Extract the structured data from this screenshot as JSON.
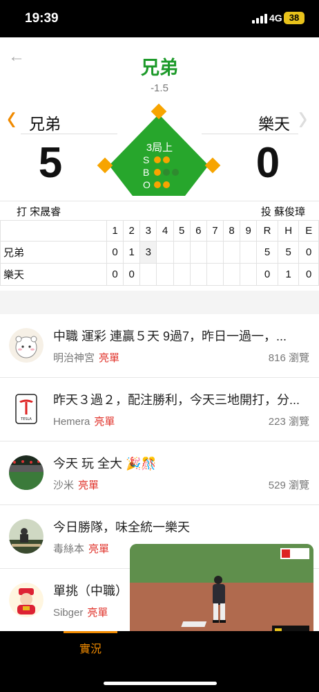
{
  "status": {
    "time": "19:39",
    "network": "4G",
    "battery": "38"
  },
  "header": {
    "title": "兄弟",
    "spread": "-1.5"
  },
  "game": {
    "away": {
      "name": "兄弟",
      "score": "5"
    },
    "home": {
      "name": "樂天",
      "score": "0"
    },
    "inning": "3局上",
    "count": {
      "strikes": 2,
      "balls": 1,
      "outs": 2,
      "s_label": "S",
      "b_label": "B",
      "o_label": "O"
    },
    "batter": "打 宋晟睿",
    "pitcher": "投 蘇俊璋"
  },
  "linescore": {
    "columns": [
      "1",
      "2",
      "3",
      "4",
      "5",
      "6",
      "7",
      "8",
      "9",
      "R",
      "H",
      "E"
    ],
    "rows": [
      {
        "team": "兄弟",
        "cells": [
          "0",
          "1",
          "3",
          "",
          "",
          "",
          "",
          "",
          "",
          "5",
          "5",
          "0"
        ]
      },
      {
        "team": "樂天",
        "cells": [
          "0",
          "0",
          "",
          "",
          "",
          "",
          "",
          "",
          "",
          "0",
          "1",
          "0"
        ]
      }
    ]
  },
  "posts": [
    {
      "title": "中職 運彩 連贏５天 9過7，昨日一過一，...",
      "author": "明治神宮",
      "badge": "亮單",
      "views": "816 瀏覽",
      "avatar_icon": "chiikawa-avatar-icon"
    },
    {
      "title": "昨天３過２，配注勝利，今天三地開打，分...",
      "author": "Hemera",
      "badge": "亮單",
      "views": "223 瀏覽",
      "avatar_icon": "tesla-logo-icon"
    },
    {
      "title": "今天 玩 全大 🎉🎊",
      "author": "沙米",
      "badge": "亮單",
      "views": "529 瀏覽",
      "avatar_icon": "stadium-avatar-icon"
    },
    {
      "title": "今日勝隊，味全統一樂天",
      "author": "毒絲本",
      "badge": "亮單",
      "views": "",
      "avatar_icon": "bench-avatar-icon"
    },
    {
      "title": "單挑（中職）",
      "author": "Sibger",
      "badge": "亮單",
      "views": "",
      "avatar_icon": "god-of-wealth-avatar-icon"
    }
  ],
  "tabbar": {
    "live": "實況"
  },
  "colors": {
    "accent": "#f08a00",
    "green": "#1d9a2a",
    "badge_red": "#e0332b"
  }
}
